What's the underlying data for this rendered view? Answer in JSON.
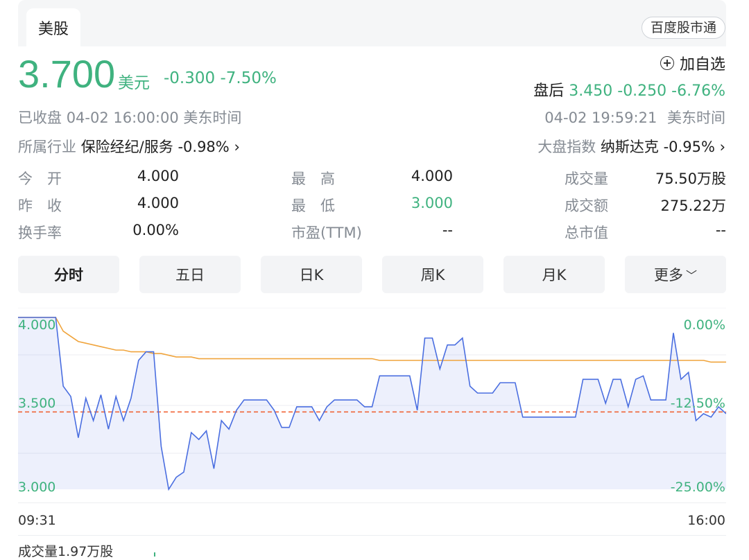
{
  "header": {
    "tab": "美股",
    "brand": "百度股市通"
  },
  "quote": {
    "price": "3.700",
    "unit": "美元",
    "change": "-0.300",
    "change_pct": "-7.50%",
    "add_watch": "加自选",
    "after_label": "盘后",
    "after_price": "3.450",
    "after_change": "-0.250",
    "after_pct": "-6.76%",
    "status": "已收盘",
    "close_time": "04-02 16:00:00",
    "tz": "美东时间",
    "after_time": "04-02 19:59:21",
    "after_tz": "美东时间",
    "industry_label": "所属行业",
    "industry_name": "保险经纪/服务",
    "industry_pct": "-0.98%",
    "index_label": "大盘指数",
    "index_name": "纳斯达克",
    "index_pct": "-0.95%"
  },
  "stats": [
    {
      "label": "今　开",
      "value": "4.000"
    },
    {
      "label": "最　高",
      "value": "4.000"
    },
    {
      "label": "成交量",
      "value": "75.50万股"
    },
    {
      "label": "昨　收",
      "value": "4.000"
    },
    {
      "label": "最　低",
      "value": "3.000"
    },
    {
      "label": "成交额",
      "value": "275.22万"
    },
    {
      "label": "换手率",
      "value": "0.00%"
    },
    {
      "label": "市盈(TTM)",
      "value": "--"
    },
    {
      "label": "总市值",
      "value": "--"
    }
  ],
  "ktabs": [
    "分时",
    "五日",
    "日K",
    "周K",
    "月K",
    "更多"
  ],
  "chart_data": {
    "type": "line",
    "y_left_ticks": [
      "4.000",
      "3.500",
      "3.000"
    ],
    "y_right_ticks": [
      "0.00%",
      "-12.50%",
      "-25.00%"
    ],
    "x_ticks": [
      "09:31",
      "16:00"
    ],
    "ylim": [
      3.0,
      4.0
    ],
    "prev_close": 3.45,
    "series": [
      {
        "values": [
          4.0,
          4.0,
          4.0,
          4.0,
          4.0,
          4.0,
          3.6,
          3.54,
          3.3,
          3.53,
          3.4,
          3.55,
          3.35,
          3.54,
          3.4,
          3.53,
          3.75,
          3.8,
          3.8,
          3.25,
          3.0,
          3.07,
          3.1,
          3.33,
          3.29,
          3.34,
          3.12,
          3.4,
          3.35,
          3.46,
          3.52,
          3.52,
          3.52,
          3.52,
          3.46,
          3.36,
          3.36,
          3.48,
          3.48,
          3.48,
          3.4,
          3.48,
          3.52,
          3.52,
          3.52,
          3.52,
          3.48,
          3.48,
          3.66,
          3.66,
          3.66,
          3.66,
          3.66,
          3.46,
          3.88,
          3.88,
          3.7,
          3.84,
          3.84,
          3.88,
          3.6,
          3.56,
          3.56,
          3.56,
          3.62,
          3.62,
          3.62,
          3.42,
          3.42,
          3.42,
          3.42,
          3.42,
          3.42,
          3.42,
          3.42,
          3.64,
          3.64,
          3.64,
          3.5,
          3.64,
          3.64,
          3.48,
          3.64,
          3.66,
          3.52,
          3.52,
          3.52,
          3.91,
          3.64,
          3.68,
          3.4,
          3.44,
          3.42,
          3.48,
          3.44
        ],
        "avg_values": [
          4.0,
          4.0,
          4.0,
          4.0,
          4.0,
          4.0,
          3.92,
          3.89,
          3.86,
          3.85,
          3.84,
          3.83,
          3.82,
          3.81,
          3.81,
          3.8,
          3.8,
          3.8,
          3.79,
          3.79,
          3.78,
          3.77,
          3.77,
          3.77,
          3.76,
          3.76,
          3.76,
          3.76,
          3.76,
          3.76,
          3.76,
          3.76,
          3.76,
          3.76,
          3.76,
          3.76,
          3.76,
          3.76,
          3.76,
          3.76,
          3.76,
          3.76,
          3.76,
          3.76,
          3.76,
          3.76,
          3.76,
          3.76,
          3.75,
          3.75,
          3.75,
          3.75,
          3.75,
          3.75,
          3.75,
          3.75,
          3.75,
          3.75,
          3.75,
          3.75,
          3.75,
          3.75,
          3.75,
          3.75,
          3.75,
          3.75,
          3.75,
          3.75,
          3.75,
          3.75,
          3.75,
          3.75,
          3.75,
          3.75,
          3.75,
          3.75,
          3.75,
          3.75,
          3.75,
          3.75,
          3.75,
          3.75,
          3.75,
          3.75,
          3.75,
          3.75,
          3.75,
          3.75,
          3.75,
          3.75,
          3.75,
          3.75,
          3.74,
          3.74,
          3.74
        ]
      }
    ]
  },
  "volume_label": "成交量1.97万股",
  "colors": {
    "green": "#3fb27f",
    "price_line": "#4a6ee0",
    "avg_line": "#f0a43c",
    "ref_line": "#f05a28"
  }
}
